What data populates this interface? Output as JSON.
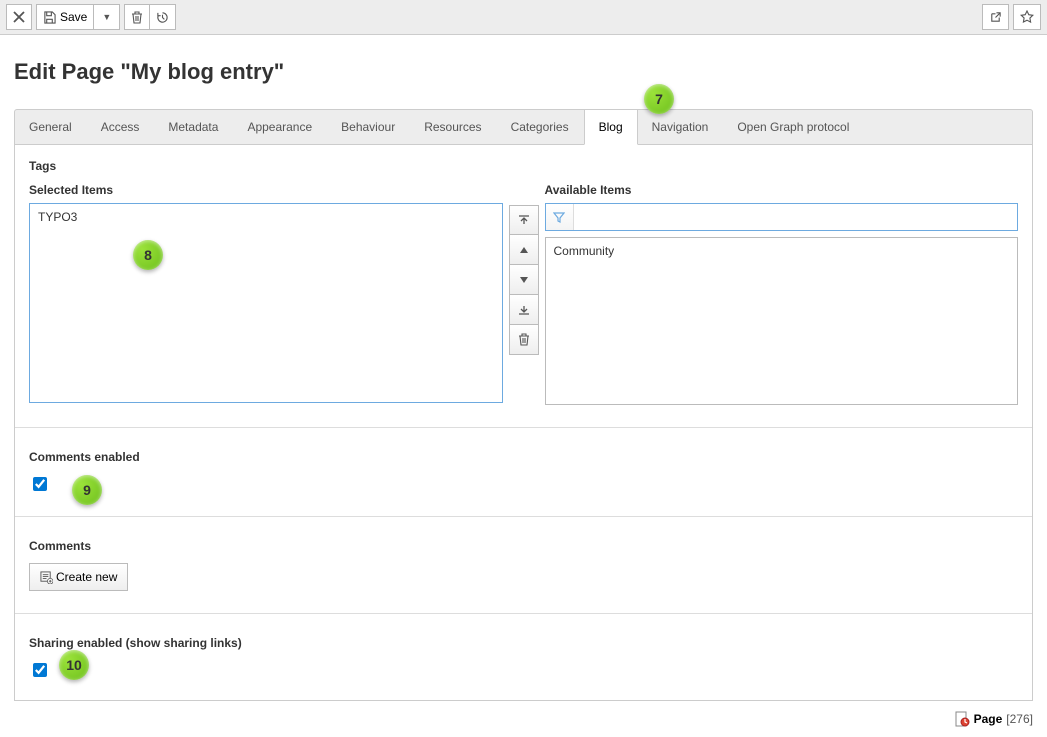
{
  "toolbar": {
    "save_label": "Save"
  },
  "page_title": "Edit Page \"My blog entry\"",
  "tabs": [
    "General",
    "Access",
    "Metadata",
    "Appearance",
    "Behaviour",
    "Resources",
    "Categories",
    "Blog",
    "Navigation",
    "Open Graph protocol"
  ],
  "active_tab": "Blog",
  "tags": {
    "heading": "Tags",
    "selected_label": "Selected Items",
    "available_label": "Available Items",
    "selected_items": [
      "TYPO3"
    ],
    "available_items": [
      "Community"
    ],
    "filter_value": ""
  },
  "comments_enabled": {
    "label": "Comments enabled",
    "checked": true
  },
  "comments": {
    "label": "Comments",
    "create_label": "Create new"
  },
  "sharing_enabled": {
    "label": "Sharing enabled (show sharing links)",
    "checked": true
  },
  "footer": {
    "type_label": "Page",
    "id": "[276]"
  },
  "annotations": {
    "a7": "7",
    "a8": "8",
    "a9": "9",
    "a10": "10"
  }
}
